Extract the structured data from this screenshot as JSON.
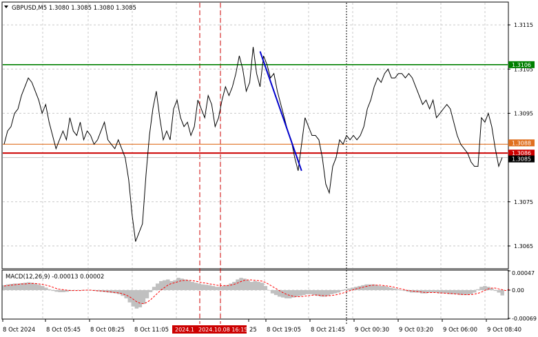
{
  "header": {
    "symbol_line": "GBPUSD,M5  1.3080 1.3085 1.3080 1.3085",
    "macd_line": "MACD(12,26,9) -0.00013 0.00002"
  },
  "colors": {
    "price_line": "#000000",
    "green_level": "#008000",
    "red_level": "#cc0000",
    "orange_level": "#e07020",
    "trend_line": "#0000cc",
    "vline_red": "#cc0000",
    "macd_hist": "#c0c0c0",
    "macd_signal": "#ff0000",
    "current_price_tag": "#000000"
  },
  "chart_data": [
    {
      "type": "line",
      "panel": "price",
      "series": [
        {
          "values": [
            1.3088,
            1.3091,
            1.3092,
            1.3095,
            1.3096,
            1.3099,
            1.3101,
            1.3103,
            1.3102,
            1.31,
            1.3098,
            1.3095,
            1.3097,
            1.3093,
            1.309,
            1.3087,
            1.3089,
            1.3091,
            1.3089,
            1.3094,
            1.3091,
            1.309,
            1.3093,
            1.3089,
            1.3091,
            1.309,
            1.3088,
            1.3089,
            1.3091,
            1.3093,
            1.3089,
            1.3088,
            1.3087,
            1.3089,
            1.3087,
            1.3085,
            1.308,
            1.3072,
            1.3066,
            1.3068,
            1.307,
            1.3081,
            1.309,
            1.3096,
            1.31,
            1.3094,
            1.3089,
            1.3091,
            1.3089,
            1.3096,
            1.3098,
            1.3094,
            1.3092,
            1.3093,
            1.309,
            1.3092,
            1.3098,
            1.3096,
            1.3094,
            1.3099,
            1.3097,
            1.3092,
            1.3094,
            1.3098,
            1.3101,
            1.3099,
            1.3101,
            1.3104,
            1.3108,
            1.3105,
            1.31,
            1.3102,
            1.311,
            1.3104,
            1.3101,
            1.3108,
            1.3106,
            1.3103,
            1.3104,
            1.31,
            1.3097,
            1.3094,
            1.3091,
            1.3089,
            1.3085,
            1.3082,
            1.3088,
            1.3094,
            1.3092,
            1.309,
            1.309,
            1.3089,
            1.3085,
            1.3079,
            1.3077,
            1.3083,
            1.3085,
            1.3089,
            1.3088,
            1.309,
            1.3089,
            1.309,
            1.3089,
            1.309,
            1.3092,
            1.3096,
            1.3098,
            1.3101,
            1.3103,
            1.3102,
            1.3104,
            1.3105,
            1.3103,
            1.3103,
            1.3104,
            1.3104,
            1.3103,
            1.3104,
            1.3103,
            1.3101,
            1.3099,
            1.3097,
            1.3098,
            1.3096,
            1.3098,
            1.3094,
            1.3095,
            1.3096,
            1.3097,
            1.3096,
            1.3093,
            1.309,
            1.3088,
            1.3087,
            1.3086,
            1.3084,
            1.3083,
            1.3083,
            1.3094,
            1.3093,
            1.3095,
            1.3092,
            1.3087,
            1.3083,
            1.3085
          ]
        }
      ],
      "ylim": [
        1.306,
        1.312
      ],
      "yticks": [
        "1.3115",
        "1.3105",
        "1.3095",
        "1.3075",
        "1.3065"
      ],
      "levels": [
        {
          "name": "green",
          "value": 1.3106,
          "label": "1.3106"
        },
        {
          "name": "orange",
          "value": 1.3088,
          "label": "1.3088"
        },
        {
          "name": "red",
          "value": 1.3086,
          "label": "1.3086"
        },
        {
          "name": "current",
          "value": 1.3085,
          "label": "1.3085"
        }
      ],
      "trend_line": {
        "from_index": 74,
        "from_value": 1.3109,
        "to_index": 86,
        "to_value": 1.3082
      }
    },
    {
      "type": "bar",
      "panel": "macd",
      "series": [
        {
          "kind": "histogram",
          "values": [
            0.00012,
            0.00014,
            0.00015,
            0.00016,
            0.00016,
            0.00017,
            0.00018,
            0.00019,
            0.00018,
            0.00016,
            0.00013,
            0.0001,
            6e-05,
            2e-05,
            -2e-05,
            -4e-05,
            -5e-05,
            -5e-05,
            -4e-05,
            -2e-05,
            -1e-05,
            -1e-05,
            0.0,
            0.0,
            0.0,
            -1e-05,
            -2e-05,
            -3e-05,
            -4e-05,
            -5e-05,
            -6e-05,
            -7e-05,
            -8e-05,
            -0.0001,
            -0.00014,
            -0.0002,
            -0.0003,
            -0.0004,
            -0.00045,
            -0.00042,
            -0.00034,
            -0.0002,
            -5e-05,
            8e-05,
            0.00016,
            0.00022,
            0.00024,
            0.00026,
            0.00022,
            0.00024,
            0.0003,
            0.00028,
            0.00026,
            0.00024,
            0.0002,
            0.00018,
            0.00016,
            0.00014,
            0.00013,
            0.00012,
            0.0001,
            8e-05,
            8e-05,
            0.0001,
            0.00012,
            0.00016,
            0.0002,
            0.00026,
            0.0003,
            0.00028,
            0.00024,
            0.0002,
            0.00022,
            0.0002,
            0.00018,
            0.0001,
            0.0,
            -8e-05,
            -0.00012,
            -0.00016,
            -0.00018,
            -0.0002,
            -0.0002,
            -0.00018,
            -0.00016,
            -0.00014,
            -0.00012,
            -0.0001,
            -0.0001,
            -0.00012,
            -0.00014,
            -0.00016,
            -0.00016,
            -0.00014,
            -0.0001,
            -8e-05,
            -6e-05,
            -2e-05,
            2e-05,
            4e-05,
            6e-05,
            8e-05,
            0.0001,
            0.00012,
            0.00014,
            0.00014,
            0.00014,
            0.00012,
            0.0001,
            0.0001,
            8e-05,
            6e-05,
            4e-05,
            2e-05,
            0.0,
            -2e-05,
            -4e-05,
            -6e-05,
            -6e-05,
            -6e-05,
            -8e-05,
            -8e-05,
            -6e-05,
            -6e-05,
            -6e-05,
            -8e-05,
            -8e-05,
            -8e-05,
            -0.0001,
            -0.0001,
            -0.0001,
            -0.00012,
            -0.00012,
            -0.00012,
            -0.0001,
            -6e-05,
            2e-05,
            8e-05,
            0.0001,
            8e-05,
            4e-05,
            -2e-05,
            -6e-05,
            -0.00013
          ]
        },
        {
          "kind": "signal",
          "values": [
            0.0001,
            0.00011,
            0.00012,
            0.00013,
            0.00014,
            0.00015,
            0.00015,
            0.00016,
            0.00016,
            0.00016,
            0.00015,
            0.00014,
            0.00012,
            0.0001,
            7e-05,
            4e-05,
            2e-05,
            1e-05,
            0.0,
            -1e-05,
            -1e-05,
            -1e-05,
            -1e-05,
            0.0,
            0.0,
            0.0,
            -1e-05,
            -2e-05,
            -2e-05,
            -3e-05,
            -4e-05,
            -5e-05,
            -6e-05,
            -7e-05,
            -9e-05,
            -0.00012,
            -0.00016,
            -0.00022,
            -0.00028,
            -0.00032,
            -0.00033,
            -0.0003,
            -0.00024,
            -0.00016,
            -8e-05,
            0.0,
            6e-05,
            0.00012,
            0.00016,
            0.00018,
            0.00021,
            0.00023,
            0.00024,
            0.00024,
            0.00023,
            0.00022,
            0.0002,
            0.00018,
            0.00017,
            0.00015,
            0.00014,
            0.00012,
            0.00011,
            0.00011,
            0.00011,
            0.00012,
            0.00014,
            0.00017,
            0.00021,
            0.00024,
            0.00025,
            0.00025,
            0.00024,
            0.00023,
            0.00022,
            0.00019,
            0.00014,
            9e-05,
            4e-05,
            -1e-05,
            -6e-05,
            -0.0001,
            -0.00013,
            -0.00015,
            -0.00016,
            -0.00016,
            -0.00015,
            -0.00014,
            -0.00013,
            -0.00012,
            -0.00012,
            -0.00013,
            -0.00014,
            -0.00014,
            -0.00013,
            -0.00012,
            -0.0001,
            -8e-05,
            -5e-05,
            -2e-05,
            0.0,
            3e-05,
            5e-05,
            7e-05,
            9e-05,
            0.00011,
            0.00012,
            0.00012,
            0.00012,
            0.00011,
            0.0001,
            9e-05,
            7e-05,
            5e-05,
            3e-05,
            1e-05,
            -1e-05,
            -2e-05,
            -3e-05,
            -4e-05,
            -5e-05,
            -6e-05,
            -6e-05,
            -6e-05,
            -6e-05,
            -7e-05,
            -7e-05,
            -8e-05,
            -8e-05,
            -9e-05,
            -0.0001,
            -0.0001,
            -0.00011,
            -0.00011,
            -0.00011,
            -0.0001,
            -8e-05,
            -5e-05,
            -1e-05,
            3e-05,
            5e-05,
            5e-05,
            3e-05,
            1e-05,
            -1e-05,
            2e-05
          ]
        }
      ],
      "ylim": [
        -0.00069,
        0.00047
      ],
      "yticks": [
        "0.00047",
        "0.00",
        "-0.00069"
      ]
    }
  ],
  "time_axis": {
    "labels": [
      "8 Oct 2024",
      "8 Oct 05:45",
      "8 Oct 08:25",
      "8 Oct 11:05",
      "25",
      "8 Oct 19:05",
      "8 Oct 21:45",
      "9 Oct 00:30",
      "9 Oct 03:20",
      "9 Oct 06:00",
      "9 Oct 08:40"
    ],
    "highlight_labels": [
      "2024.1",
      "2024.10.08 16:15"
    ]
  }
}
